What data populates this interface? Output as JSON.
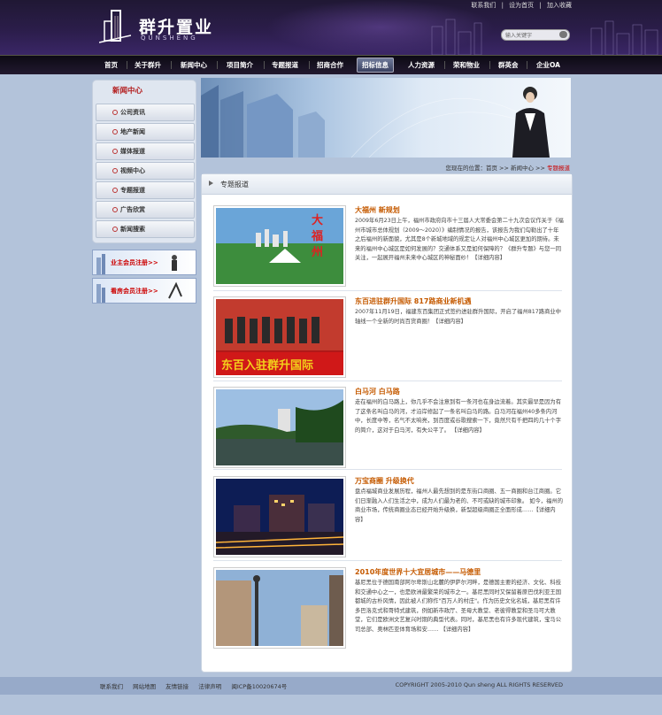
{
  "header": {
    "logo_cn": "群升置业",
    "logo_en": "QUNSHENG",
    "toplinks": [
      "联系我们",
      "|",
      "设为首页",
      "|",
      "加入收藏"
    ],
    "search_placeholder": "输入关键字"
  },
  "nav": {
    "items": [
      "首页",
      "关于群升",
      "新闻中心",
      "项目简介",
      "专题报道",
      "招商合作",
      "招标信息",
      "人力资源",
      "荣和物业",
      "群英会",
      "企业OA"
    ],
    "active_index": 6
  },
  "sidebar": {
    "title": "新闻中心",
    "items": [
      "公司资讯",
      "地产新闻",
      "媒体报道",
      "视频中心",
      "专题报道",
      "广告欣赏",
      "新闻搜索"
    ],
    "banners": [
      "业主会员注册>>",
      "看房会员注册>>"
    ]
  },
  "breadcrumb": {
    "prefix": "您现在的位置：首页 >> 新闻中心 >>",
    "current": "专题报道"
  },
  "panel": {
    "title": "专题报道"
  },
  "articles": [
    {
      "title": "大福州 新规划",
      "body": "2009年6月23日上午，福州市政府向市十三届人大常委会第二十九次会议作关于《福州市城市总体规划（2009～2020）》编制情况的报告，该报告为我们勾勒出了十年之后福州的新面貌，尤其是8个新城地域的规定让人对福州中心城区更加的期待。未来的福州中心城区是如何发展的？交通体系又是如何保障的？《群升专题》与您一同关注，一起展开福州未来中心城区的神秘面纱！【详细内容】",
      "img_text": "大福州新规划"
    },
    {
      "title": "东百进驻群升国际 817路商业新机遇",
      "body": "2007年11月19日，福建东百集团正式签约进驻群升国际，开启了福州817路商业中轴线一个全新的时尚百货商圈！【详细内容】",
      "img_text": "东百入驻群升国际"
    },
    {
      "title": "白马河 白马路",
      "body": "走在福州的白马路上，你几乎不会注意到有一条河也在身边流着。其实最早是因为有了这条名叫白马的河，才沿岸修起了一条名叫白马的路。白马河在福州40多条内河中，长度中等，名气不太响亮，到百度或谷歌搜索一下，竟然只有千把四的几十个字的简介，这对于白马河，有失公平了。 【详细内容】"
    },
    {
      "title": "万宝商圈 升级换代",
      "body": "盘点福城商业发展历程，福州人最先想到的是东街口商圈、五一商圈和台江商圈。它们日渐融入人们生活之中，成为人们最为老的、不可或缺的城市印象。 如今，福州的商业市场，传统商圈业态已经开始升级换，新型超级商圈正全面形成……【详细内容】"
    },
    {
      "title": "2010年度世界十大宜居城市——马德里",
      "body": "基尼黑位于德国南部阿尔卑斯山北麓的伊萨尔河畔，是德国主要的经济、文化、科技和交通中心之一，也是欧洲最繁荣的城市之一。基尼黑同时又保留着原巴伐利亚王国都城的古朴风情，因此被人们称作\"百万人的村庄\"。作为历史文化名城，基尼黑有许多巴洛克式和哥特式建筑，例如新市政厅、圣母大教堂、老彼得教堂和圣马可大教堂，它们是欧洲文艺复兴时期的典型代表。同时，基尼黑也有许多现代建筑，宝马公司总部、奥林匹亚体育场和安…… 【详细内容】"
    }
  ],
  "footer": {
    "links": [
      "联系我们",
      "网站地图",
      "友情链接",
      "法律声明",
      "闽ICP备10020674号"
    ],
    "copyright": "COPYRIGHT 2005-2010 Qun sheng ALL RIGHTS RESERVED"
  },
  "colors": {
    "header_bg": "#2b1d4a",
    "page_bg": "#b3c3da",
    "accent_red": "#b21a1a",
    "title_orange": "#c55a00"
  }
}
